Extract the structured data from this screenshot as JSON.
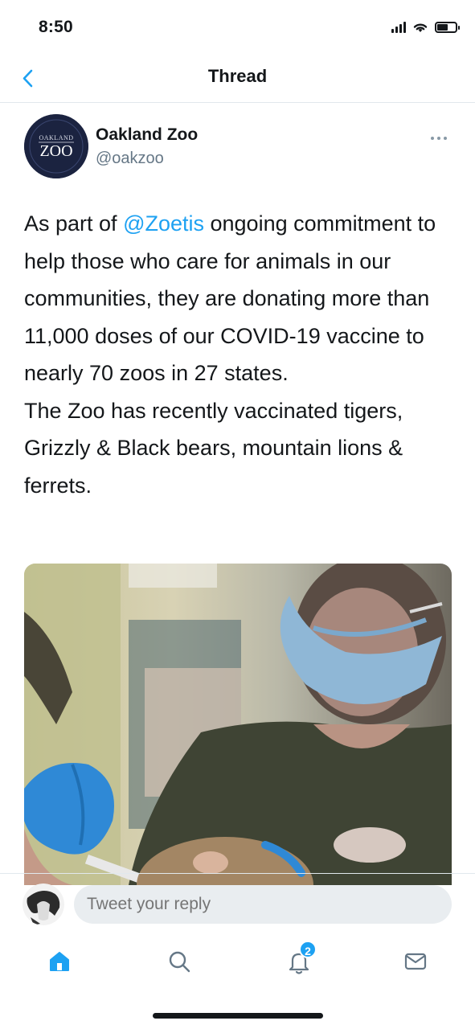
{
  "status_bar": {
    "time": "8:50"
  },
  "nav": {
    "title": "Thread",
    "back_icon": "chevron-left-icon"
  },
  "tweet": {
    "author": {
      "name": "Oakland Zoo",
      "handle": "@oakzoo",
      "avatar_text_top": "OAKLAND",
      "avatar_text_main": "ZOO"
    },
    "text": {
      "paragraph1_before": "As part of ",
      "mention": "@Zoetis",
      "paragraph1_after": " ongoing commitment to help those who care for animals in our communities, they are donating more than 11,000 doses of our COVID-19 vaccine to nearly 70 zoos in 27 states.",
      "paragraph2": "The Zoo has recently vaccinated tigers, Grizzly & Black bears, mountain lions & ferrets."
    },
    "media": "photo of zoo staff member in mask and blue gloves vaccinating an animal"
  },
  "reply": {
    "placeholder": "Tweet your reply"
  },
  "tab_bar": {
    "tabs": [
      {
        "icon": "home-icon",
        "active": true
      },
      {
        "icon": "search-icon",
        "active": false
      },
      {
        "icon": "notifications-icon",
        "active": false,
        "badge": "2"
      },
      {
        "icon": "messages-icon",
        "active": false
      }
    ]
  },
  "colors": {
    "accent": "#1da1f2",
    "text": "#14171a",
    "secondary_text": "#657786",
    "border": "#e1e8ed",
    "avatar_bg": "#1b2340"
  }
}
